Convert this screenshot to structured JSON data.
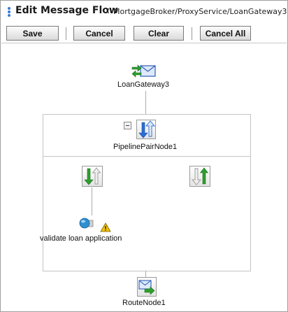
{
  "header": {
    "title": "Edit Message Flow",
    "separator": ":",
    "path": "MortgageBroker/ProxyService/LoanGateway3"
  },
  "toolbar": {
    "save_label": "Save",
    "cancel_label": "Cancel",
    "clear_label": "Clear",
    "cancel_all_label": "Cancel All"
  },
  "flow": {
    "start_node": {
      "label": "LoanGateway3",
      "icon": "proxy-service-envelope-icon"
    },
    "pipeline_pair": {
      "label": "PipelinePairNode1",
      "icon": "pipeline-pair-icon",
      "collapse_icon": "minus-icon"
    },
    "request_pipeline": {
      "icon": "request-pipeline-icon"
    },
    "response_pipeline": {
      "icon": "response-pipeline-icon"
    },
    "stage": {
      "label": "validate loan application",
      "icon": "stage-icon",
      "warning_icon": "warning-icon"
    },
    "route_node": {
      "label": "RouteNode1",
      "icon": "route-node-icon"
    }
  },
  "colors": {
    "blue_arrow": "#2b6fd6",
    "green_arrow": "#2e9e2e",
    "warning": "#f2c200"
  }
}
